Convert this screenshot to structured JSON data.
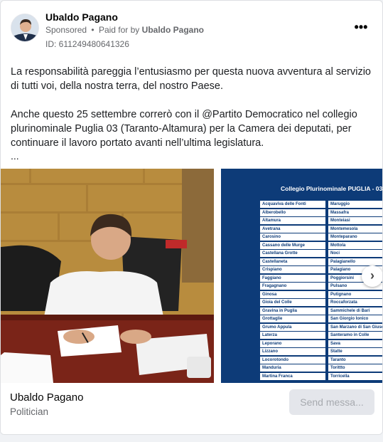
{
  "post": {
    "page_name": "Ubaldo Pagano",
    "sponsored_label": "Sponsored",
    "separator": "•",
    "paid_for_prefix": "Paid for by",
    "paid_for_name": "Ubaldo Pagano",
    "ad_id": "ID: 611249480641326",
    "more_icon": "•••",
    "paragraph1": "La responsabilità pareggia l’entusiasmo per questa nuova avventura al servizio di tutti voi, della nostra terra, del nostro Paese.",
    "paragraph2": "Anche questo 25 settembre correrò con il @Partito Democratico nel collegio plurinominale Puglia 03 (Taranto-Altamura) per la Camera dei deputati, per continuare il lavoro portato avanti nell’ultima legislatura.",
    "ellipsis": "..."
  },
  "carousel": {
    "slide2_title": "Collegio Plurinominale PUGLIA - 03",
    "list_left": [
      "Acquaviva delle Fonti",
      "Alberobello",
      "Altamura",
      "Avetrana",
      "Carosino",
      "Cassano delle Murge",
      "Castellana Grotte",
      "Castellaneta",
      "Crispiano",
      "Faggiano",
      "Fragagnano",
      "Ginosa",
      "Gioia del Colle",
      "Gravina in Puglia",
      "Grottaglie",
      "Grumo Appula",
      "Laterza",
      "Leporano",
      "Lizzano",
      "Locorotondo",
      "Manduria",
      "Martina Franca"
    ],
    "list_right": [
      "Maruggio",
      "Massafra",
      "Monteiasi",
      "Montemesola",
      "Monteparano",
      "Mottola",
      "Noci",
      "Palagianello",
      "Palagiano",
      "Poggiorsini",
      "Pulsano",
      "Putignano",
      "Roccaforzata",
      "Sammichele di Bari",
      "San Giorgio Ionico",
      "San Marzano di San Giuseppe",
      "Santeramo in Colle",
      "Sava",
      "Statte",
      "Taranto",
      "Torittto",
      "Torricella"
    ],
    "next_icon": "›"
  },
  "footer": {
    "name": "Ubaldo Pagano",
    "category": "Politician",
    "send_button": "Send messa..."
  }
}
